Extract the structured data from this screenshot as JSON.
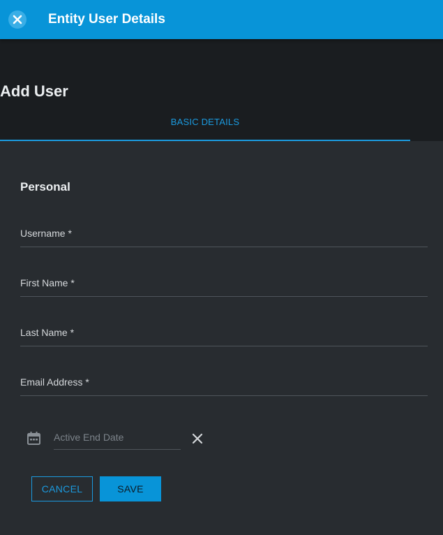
{
  "topbar": {
    "title": "Entity User Details",
    "close_icon": "close-icon"
  },
  "header": {
    "page_title": "Add User",
    "tabs": [
      {
        "label": "BASIC DETAILS",
        "active": true
      }
    ]
  },
  "form": {
    "section_title": "Personal",
    "fields": [
      {
        "label": "Username *",
        "value": ""
      },
      {
        "label": "First Name *",
        "value": ""
      },
      {
        "label": "Last Name *",
        "value": ""
      },
      {
        "label": "Email Address *",
        "value": ""
      }
    ],
    "active_end_date": {
      "placeholder": "Active End Date",
      "icon": "calendar-icon",
      "clear_icon": "close-icon"
    }
  },
  "actions": {
    "cancel_label": "CANCEL",
    "save_label": "SAVE"
  },
  "colors": {
    "accent": "#0894d8",
    "tab_accent": "#1b9be0",
    "header_bg": "#1a1d20",
    "body_bg": "#282c30"
  }
}
